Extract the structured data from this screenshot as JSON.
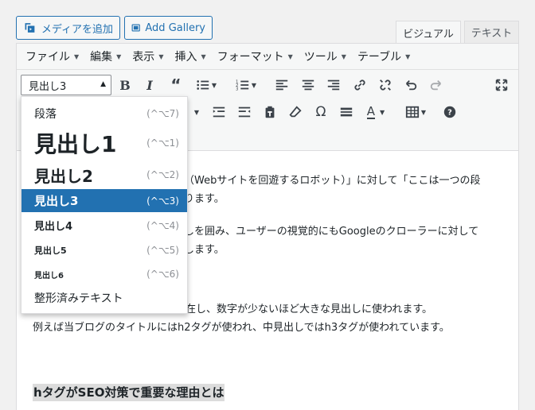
{
  "media_buttons": {
    "add_media_label": "メディアを追加",
    "add_gallery_label": "Add Gallery"
  },
  "tabs": {
    "visual": "ビジュアル",
    "text": "テキスト"
  },
  "menubar": [
    "ファイル",
    "編集",
    "表示",
    "挿入",
    "フォーマット",
    "ツール",
    "テーブル"
  ],
  "format_select": {
    "value": "見出し3"
  },
  "dropdown": {
    "items": [
      {
        "label": "段落",
        "shortcut": "(^⌥7)"
      },
      {
        "label": "見出し1",
        "shortcut": "(^⌥1)"
      },
      {
        "label": "見出し2",
        "shortcut": "(^⌥2)"
      },
      {
        "label": "見出し3",
        "shortcut": "(^⌥3)",
        "selected": true
      },
      {
        "label": "見出し4",
        "shortcut": "(^⌥4)"
      },
      {
        "label": "見出し5",
        "shortcut": "(^⌥5)"
      },
      {
        "label": "見出し6",
        "shortcut": "(^⌥6)"
      },
      {
        "label": "整形済みテキスト",
        "shortcut": ""
      }
    ]
  },
  "content": {
    "line1": "（Webサイトを回遊するロボット）」に対して「ここは一つの段",
    "line2": "ります。",
    "line3": "しを囲み、ユーザーの視覚的にもGoogleのクローラーに対して",
    "line4": "します。",
    "line5": "在し、数字が少ないほど大きな見出しに使われます。",
    "line6": "例えば当ブログのタイトルにはh2タグが使われ、中見出しではh3タグが使われています。",
    "heading": "hタグがSEO対策で重要な理由とは"
  },
  "colors": {
    "accent": "#2271b1",
    "toolbar_bg": "#f6f7f7",
    "selected_bg": "#2271b1"
  }
}
